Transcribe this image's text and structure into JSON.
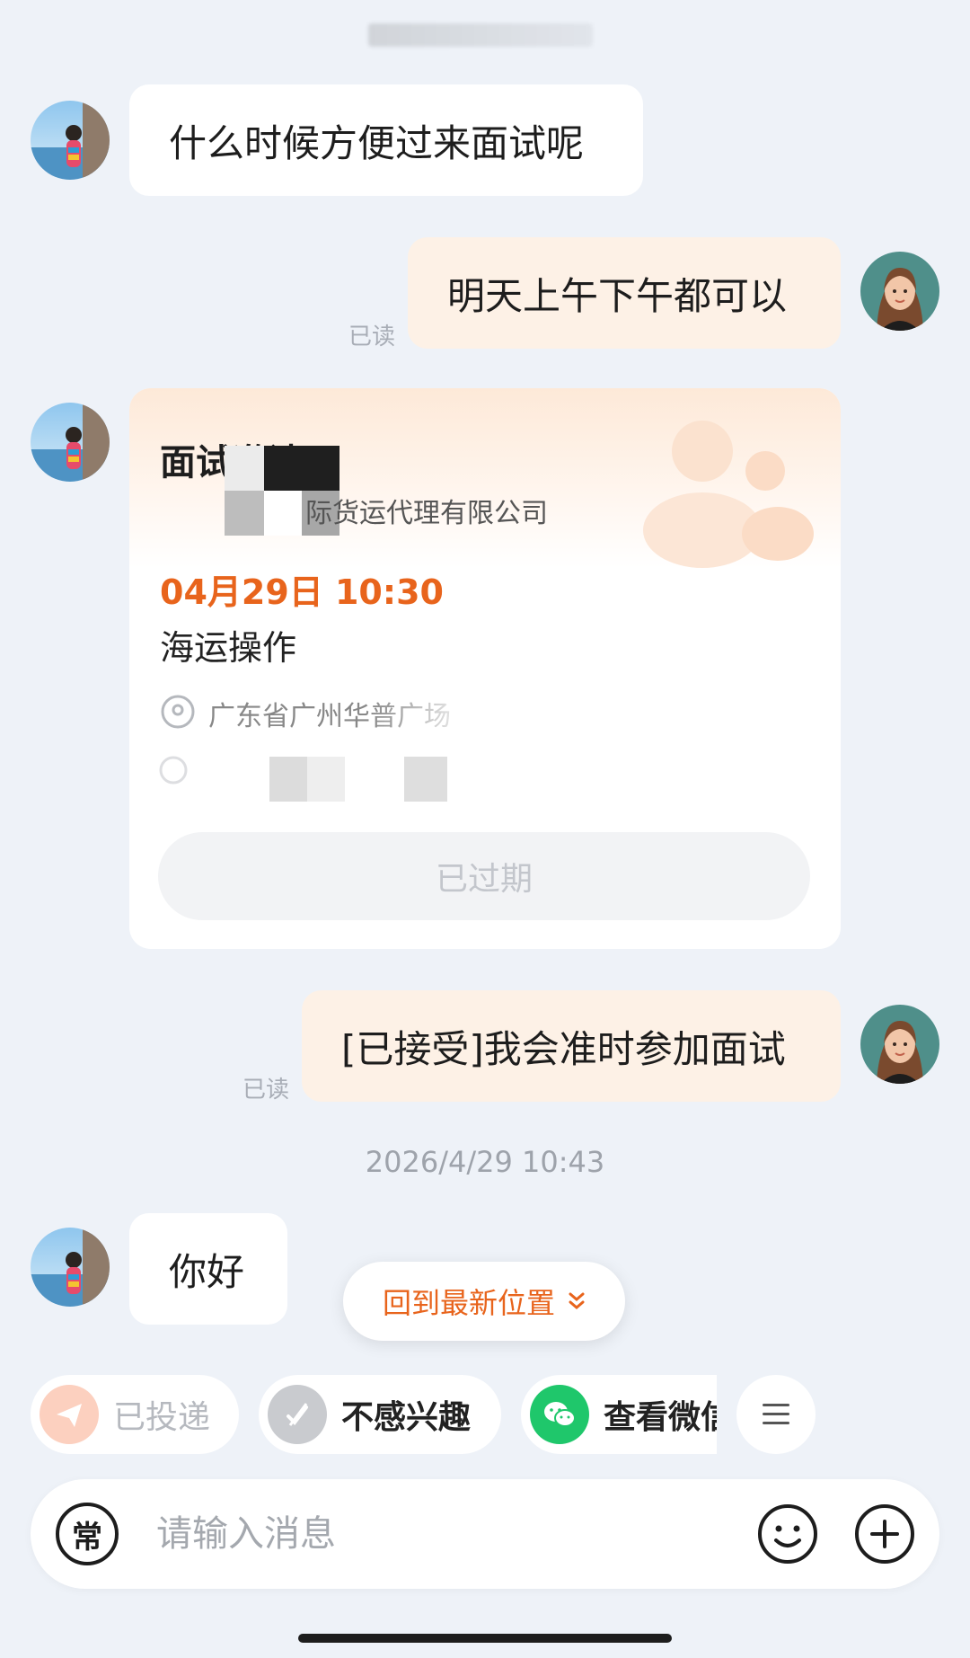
{
  "messages": [
    {
      "side": "in",
      "text": "什么时候方便过来面试呢"
    },
    {
      "side": "out",
      "text": "明天上午下午都可以",
      "status": "已读"
    },
    {
      "side": "out",
      "text": "[已接受]我会准时参加面试",
      "status": "已读"
    },
    {
      "side": "in",
      "text": "你好"
    }
  ],
  "interview_card": {
    "title": "面试邀请",
    "company": "际货运代理有限公司",
    "datetime": "04月29日 10:30",
    "position": "海运操作",
    "address": "广东省广州华普广场",
    "status_button": "已过期"
  },
  "timestamp": "2026/4/29 10:43",
  "back_to_latest": "回到最新位置",
  "quick_actions": {
    "delivered": "已投递",
    "not_interested": "不感兴趣",
    "view_wechat": "查看微信"
  },
  "input": {
    "common_phrase_label": "常",
    "placeholder": "请输入消息"
  },
  "colors": {
    "accent": "#e8641c",
    "outgoing_bubble": "#fdf1e6",
    "incoming_bubble": "#ffffff",
    "background": "#eef2f8",
    "wechat_green": "#1fc76b"
  }
}
